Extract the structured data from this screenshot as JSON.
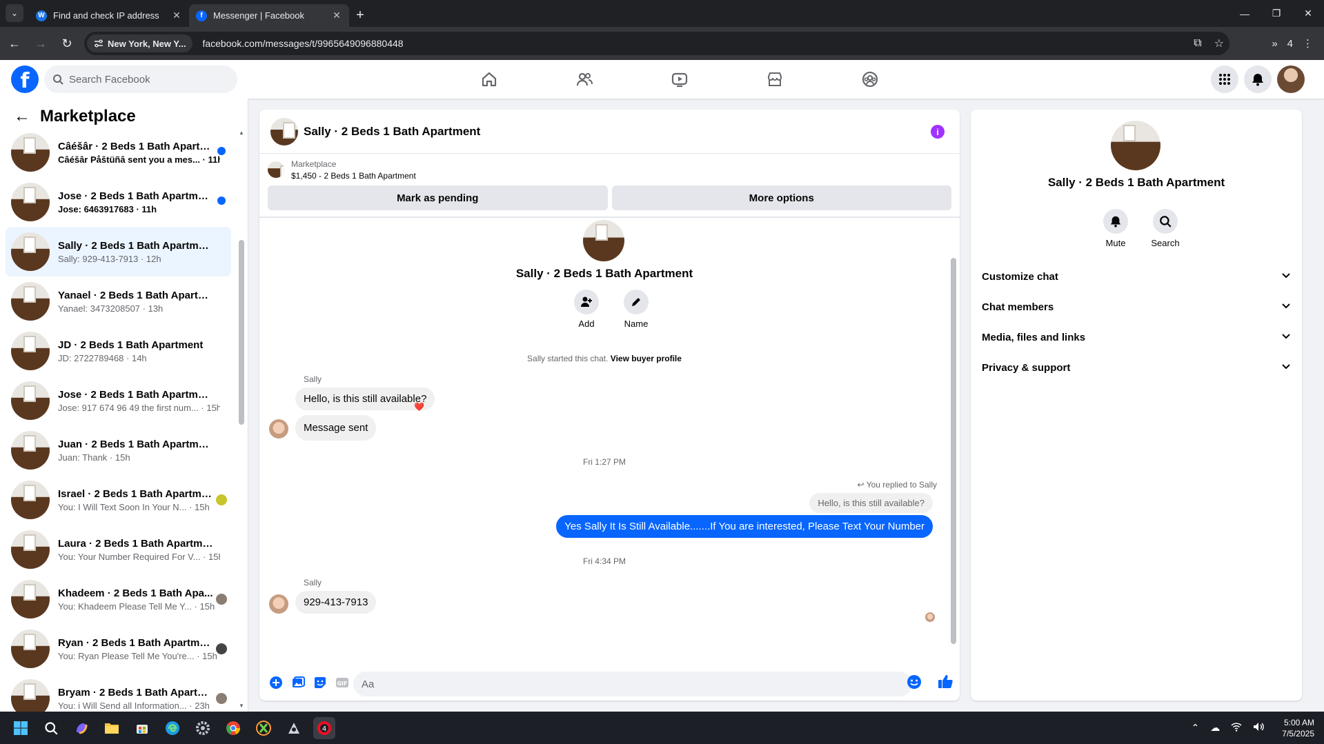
{
  "browser": {
    "tabs": [
      {
        "title": "Find and check IP address",
        "favicon_letter": "W",
        "favicon_color": "#1a73e8",
        "active": false
      },
      {
        "title": "Messenger | Facebook",
        "favicon_letter": "f",
        "favicon_color": "#0866ff",
        "active": true
      }
    ],
    "location_chip": "New York, New Y...",
    "url": "facebook.com/messages/t/9965649096880448",
    "ext_count": "4"
  },
  "fb": {
    "search_placeholder": "Search Facebook"
  },
  "sidebar": {
    "title": "Marketplace",
    "conversations": [
      {
        "name": "Câéšâr · 2 Beds 1 Bath Apartm...",
        "preview": "Câéšâr Påštüñâ sent you a mes... · 11h",
        "unread": true,
        "badge": "dot"
      },
      {
        "name": "Jose · 2 Beds 1 Bath Apartment",
        "preview": "Jose: 6463917683 · 11h",
        "unread": true,
        "badge": "dot"
      },
      {
        "name": "Sally · 2 Beds 1 Bath Apartment",
        "preview": "Sally: 929-413-7913 · 12h",
        "unread": false,
        "active": true,
        "badge": ""
      },
      {
        "name": "Yanael · 2 Beds 1 Bath Apartment",
        "preview": "Yanael: 3473208507 · 13h",
        "unread": false,
        "badge": ""
      },
      {
        "name": "JD · 2 Beds 1 Bath Apartment",
        "preview": "JD: 2722789468 · 14h",
        "unread": false,
        "badge": ""
      },
      {
        "name": "Jose · 2 Beds 1 Bath Apartment",
        "preview": "Jose: 917 674 96 49 the first num... · 15h",
        "unread": false,
        "badge": ""
      },
      {
        "name": "Juan · 2 Beds 1 Bath Apartment",
        "preview": "Juan: Thank · 15h",
        "unread": false,
        "badge": ""
      },
      {
        "name": "Israel · 2 Beds 1 Bath Apartme...",
        "preview": "You: I Will Text Soon In Your N... · 15h",
        "unread": false,
        "badge": "y"
      },
      {
        "name": "Laura · 2 Beds 1 Bath Apartment",
        "preview": "You: Your Number Required For V... · 15h",
        "unread": false,
        "badge": ""
      },
      {
        "name": "Khadeem · 2 Beds 1 Bath Apa...",
        "preview": "You: Khadeem Please Tell Me Y... · 15h",
        "unread": false,
        "badge": "g"
      },
      {
        "name": "Ryan · 2 Beds 1 Bath Apartment",
        "preview": "You: Ryan Please Tell Me You're... · 15h",
        "unread": false,
        "badge": "d"
      },
      {
        "name": "Bryam · 2 Beds 1 Bath Apartm...",
        "preview": "You: i Will Send all Information... · 23h",
        "unread": false,
        "badge": "g"
      }
    ]
  },
  "chat": {
    "header_title": "Sally · 2 Beds 1 Bath Apartment",
    "marketplace_label": "Marketplace",
    "listing": "$1,450 - 2 Beds 1 Bath Apartment",
    "mark_pending": "Mark as pending",
    "more_options": "More options",
    "intro_title": "Sally · 2 Beds 1 Bath Apartment",
    "add_label": "Add",
    "name_label": "Name",
    "started_text": "Sally started this chat.",
    "view_profile": "View buyer profile",
    "sender1": "Sally",
    "msg1": "Hello, is this still available?",
    "reaction1": "❤️",
    "msg2": "Message sent",
    "time1": "Fri 1:27 PM",
    "replied_label": "You replied to Sally",
    "quoted": "Hello, is this still available?",
    "msg3": "Yes Sally It Is Still Available.......If You are interested, Please Text Your Number",
    "time2": "Fri 4:34 PM",
    "sender2": "Sally",
    "msg4": "929-413-7913",
    "composer_placeholder": "Aa"
  },
  "details": {
    "title": "Sally · 2 Beds 1 Bath Apartment",
    "mute": "Mute",
    "search": "Search",
    "sections": [
      "Customize chat",
      "Chat members",
      "Media, files and links",
      "Privacy & support"
    ]
  },
  "taskbar": {
    "time": "5:00 AM",
    "date": "7/5/2025"
  },
  "colors": {
    "brand": "#0866ff",
    "info": "#a033ff",
    "active_row": "#ebf5ff"
  }
}
